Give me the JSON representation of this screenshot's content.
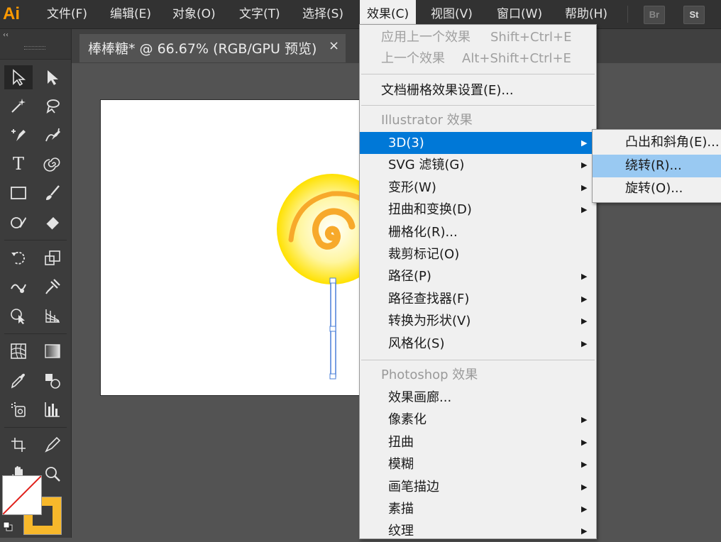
{
  "app": {
    "logo": "Ai",
    "bridge_btn": "Br",
    "stock_btn": "St"
  },
  "menubar": {
    "items": [
      "文件(F)",
      "编辑(E)",
      "对象(O)",
      "文字(T)",
      "选择(S)",
      "效果(C)",
      "视图(V)",
      "窗口(W)",
      "帮助(H)"
    ],
    "active": "效果(C)"
  },
  "document": {
    "tab_title": "棒棒糖* @ 66.67% (RGB/GPU 预览)",
    "close": "×"
  },
  "tools_panel": {
    "collapse": "‹‹"
  },
  "colors": {
    "fill": "#ffffff",
    "stroke": "#f7b82b",
    "menu_highlight": "#0078d7",
    "submenu_highlight": "#99c9f2"
  },
  "effect_menu": {
    "apply_last": {
      "label": "应用上一个效果",
      "shortcut": "Shift+Ctrl+E"
    },
    "last": {
      "label": "上一个效果",
      "shortcut": "Alt+Shift+Ctrl+E"
    },
    "raster_settings": "文档栅格效果设置(E)...",
    "illustrator_header": "Illustrator 效果",
    "illustrator_items": [
      {
        "label": "3D(3)",
        "arrow": "▶"
      },
      {
        "label": "SVG 滤镜(G)",
        "arrow": "▶"
      },
      {
        "label": "变形(W)",
        "arrow": "▶"
      },
      {
        "label": "扭曲和变换(D)",
        "arrow": "▶"
      },
      {
        "label": "栅格化(R)...",
        "arrow": ""
      },
      {
        "label": "裁剪标记(O)",
        "arrow": ""
      },
      {
        "label": "路径(P)",
        "arrow": "▶"
      },
      {
        "label": "路径查找器(F)",
        "arrow": "▶"
      },
      {
        "label": "转换为形状(V)",
        "arrow": "▶"
      },
      {
        "label": "风格化(S)",
        "arrow": "▶"
      }
    ],
    "photoshop_header": "Photoshop 效果",
    "photoshop_items": [
      {
        "label": "效果画廊...",
        "arrow": ""
      },
      {
        "label": "像素化",
        "arrow": "▶"
      },
      {
        "label": "扭曲",
        "arrow": "▶"
      },
      {
        "label": "模糊",
        "arrow": "▶"
      },
      {
        "label": "画笔描边",
        "arrow": "▶"
      },
      {
        "label": "素描",
        "arrow": "▶"
      },
      {
        "label": "纹理",
        "arrow": "▶"
      }
    ]
  },
  "submenu_3d": {
    "items": [
      "凸出和斜角(E)...",
      "绕转(R)...",
      "旋转(O)..."
    ],
    "highlighted": "绕转(R)..."
  }
}
